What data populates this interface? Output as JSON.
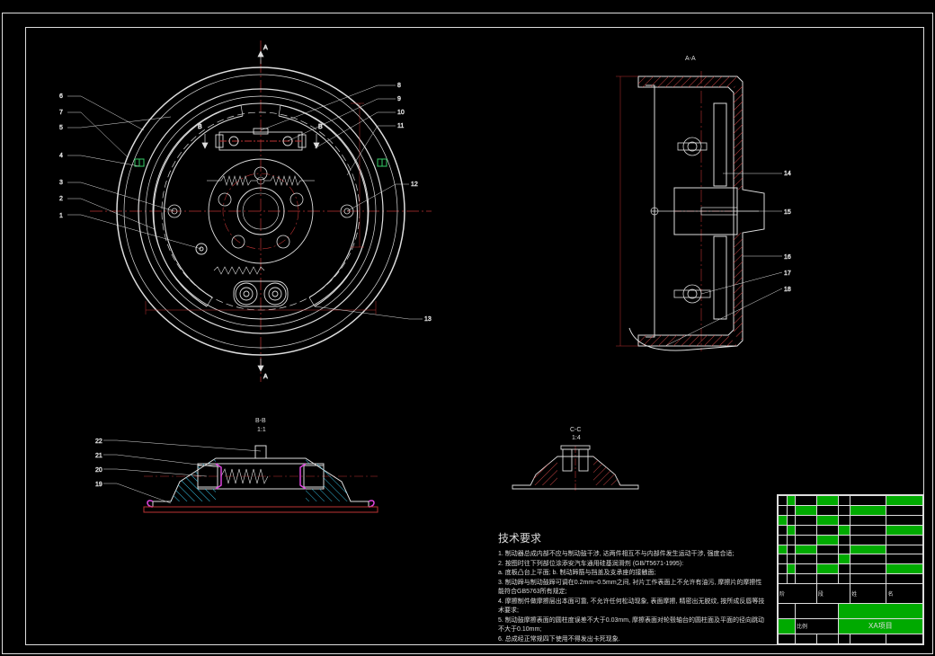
{
  "doc_type": "cad_drawing",
  "views": {
    "front": {
      "label": "A",
      "section_arrows": "A"
    },
    "section_a": {
      "label": "A-A"
    },
    "section_b": {
      "label": "B-B",
      "scale": "1:1"
    },
    "section_c": {
      "label": "C-C",
      "scale": "1:4"
    }
  },
  "callouts_front": [
    "1",
    "2",
    "3",
    "4",
    "5",
    "6",
    "7",
    "8",
    "9",
    "10",
    "11",
    "12",
    "13"
  ],
  "callouts_section_a": [
    "14",
    "15",
    "16",
    "17",
    "18"
  ],
  "callouts_section_b": [
    "19",
    "20",
    "21",
    "22"
  ],
  "tech_requirements": {
    "title": "技术要求",
    "items": [
      "1. 制动器总成内部不应与制动鼓干涉, 达两件相互不与内部件发生运动干涉, 强度合适;",
      "2. 按图时往下列部位涂添安汽车通用硅基润滑剂 (GB/T5671-1995):",
      "   a. 底板凸台上平面;  b. 制动蹄筋与挡盖及支承座的接触面;",
      "3. 制动蹄与制动鼓蹄可调在0.2mm~0.5mm之间, 衬片工作表面上不允许有油污, 摩擦片的摩擦性能符合GB5763所有规定;",
      "4. 摩擦制件做摩擦层出本面可靠, 不允许任何松动现象, 表面摩擦, 精密出无脱纹, 按所成反唇等技术要求;",
      "5. 制动鼓摩擦表面的圆柱度误差不大于0.03mm, 摩擦表面对轮毂轴台的圆柱面及平面的径向跳动不大于0.10mm;",
      "6. 总成经正常规四下使用不得发出卡死现象."
    ]
  },
  "title_block": {
    "rows_top": [
      [
        "",
        "",
        "",
        "",
        "",
        "",
        ""
      ],
      [
        "",
        "",
        "",
        "",
        "",
        "",
        ""
      ],
      [
        "",
        "",
        "",
        "",
        "",
        "",
        ""
      ],
      [
        "",
        "",
        "",
        "",
        "",
        "",
        ""
      ],
      [
        "",
        "",
        "",
        "",
        "",
        "",
        ""
      ],
      [
        "",
        "",
        "",
        "",
        "",
        "",
        ""
      ],
      [
        "",
        "",
        "",
        "",
        "",
        "",
        ""
      ],
      [
        "",
        "",
        "",
        "",
        "",
        "",
        ""
      ],
      [
        "",
        "",
        "",
        "",
        "",
        "",
        ""
      ]
    ],
    "main": {
      "part_name": "",
      "col1": "阶",
      "col2": "段",
      "col3": "姓",
      "col4": "名",
      "drawing_no": "",
      "project": "",
      "scale_label": "比例",
      "scale_value": "",
      "company": "XA项目"
    }
  }
}
